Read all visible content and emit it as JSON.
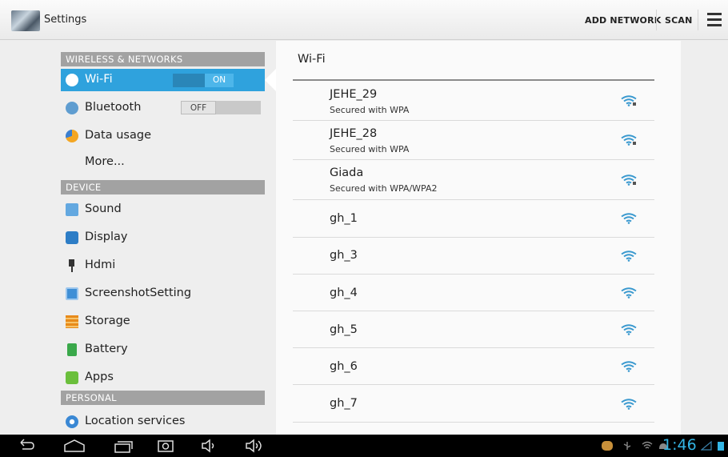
{
  "app": {
    "title": "Settings"
  },
  "actionbar": {
    "add_network": "ADD NETWORK",
    "scan": "SCAN"
  },
  "sidebar": {
    "sections": [
      {
        "category": "WIRELESS & NETWORKS"
      },
      {
        "category": "DEVICE"
      },
      {
        "category": "PERSONAL"
      }
    ],
    "items": [
      {
        "label": "Wi-Fi",
        "icon": "wifi-icon",
        "toggle": "ON",
        "selected": true
      },
      {
        "label": "Bluetooth",
        "icon": "bluetooth-icon",
        "toggle": "OFF"
      },
      {
        "label": "Data usage",
        "icon": "data-usage-icon"
      },
      {
        "label": "More..."
      },
      {
        "label": "Sound",
        "icon": "sound-icon"
      },
      {
        "label": "Display",
        "icon": "display-icon"
      },
      {
        "label": "Hdmi",
        "icon": "hdmi-icon"
      },
      {
        "label": "ScreenshotSetting",
        "icon": "screenshot-icon"
      },
      {
        "label": "Storage",
        "icon": "storage-icon"
      },
      {
        "label": "Battery",
        "icon": "battery-icon"
      },
      {
        "label": "Apps",
        "icon": "apps-icon"
      },
      {
        "label": "Location services",
        "icon": "location-icon"
      }
    ]
  },
  "wifi": {
    "title": "Wi-Fi",
    "networks": [
      {
        "ssid": "JEHE_29",
        "security": "Secured with WPA",
        "secured": true
      },
      {
        "ssid": "JEHE_28",
        "security": "Secured with WPA",
        "secured": true
      },
      {
        "ssid": "Giada",
        "security": "Secured with WPA/WPA2",
        "secured": true
      },
      {
        "ssid": "gh_1",
        "security": "",
        "secured": false
      },
      {
        "ssid": "gh_3",
        "security": "",
        "secured": false
      },
      {
        "ssid": "gh_4",
        "security": "",
        "secured": false
      },
      {
        "ssid": "gh_5",
        "security": "",
        "secured": false
      },
      {
        "ssid": "gh_6",
        "security": "",
        "secured": false
      },
      {
        "ssid": "gh_7",
        "security": "",
        "secured": false
      }
    ]
  },
  "statusbar": {
    "time": "1:46"
  },
  "colors": {
    "accent": "#33b5e5",
    "selected": "#2fa2dd",
    "category": "#a2a2a2"
  }
}
